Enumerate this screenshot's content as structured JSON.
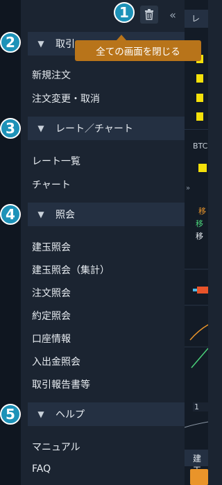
{
  "sidebar": {
    "tooltip": "全ての画面を閉じる",
    "collapse_icon": "«",
    "sections": [
      {
        "label": "取引",
        "items": [
          "新規注文",
          "注文変更・取消"
        ]
      },
      {
        "label": "レート／チャート",
        "items": [
          "レート一覧",
          "チャート"
        ]
      },
      {
        "label": "照会",
        "items": [
          "建玉照会",
          "建玉照会（集計）",
          "注文照会",
          "約定照会",
          "口座情報",
          "入出金照会",
          "取引報告書等"
        ]
      },
      {
        "label": "ヘルプ",
        "items": [
          "マニュアル",
          "FAQ"
        ]
      }
    ]
  },
  "badges": [
    "1",
    "2",
    "3",
    "4",
    "5"
  ],
  "right_panel": {
    "header_text": "レ",
    "symbol_text": "BTC",
    "expand_icon": "»",
    "chart_labels": [
      "移",
      "移",
      "移"
    ],
    "axis_value": "1",
    "footer_text": "建玉"
  },
  "colors": {
    "accent_badge": "#1d92b8",
    "tooltip_bg": "#b8741a",
    "sidebar_bg": "#1b2431",
    "section_bg": "#243042",
    "marker_yellow": "#f5e10a"
  }
}
